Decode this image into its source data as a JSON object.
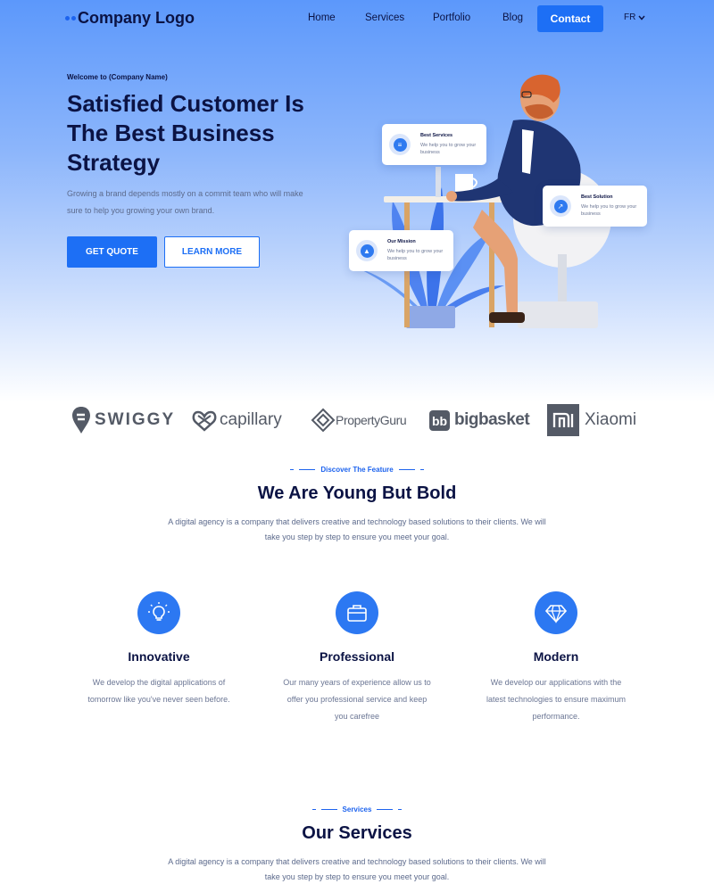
{
  "nav": {
    "logo": "Company Logo",
    "links": [
      "Home",
      "Services",
      "Portfolio",
      "Blog"
    ],
    "contact": "Contact",
    "language": "FR"
  },
  "hero": {
    "welcome": "Welcome to (Company Name)",
    "title": "Satisfied Customer Is The Best Business Strategy",
    "description": "Growing a brand depends mostly on a commit team who will make sure to help you growing your own brand.",
    "primary_button": "GET QUOTE",
    "secondary_button": "LEARN MORE",
    "cards": [
      {
        "title": "Best Services",
        "text": "We help you to grow your business",
        "icon": "layers-icon"
      },
      {
        "title": "Best Solution",
        "text": "We help you to grow your business",
        "icon": "chart-icon"
      },
      {
        "title": "Our Mission",
        "text": "We help you to grow your business",
        "icon": "rocket-icon"
      }
    ]
  },
  "brands": [
    "SWIGGY",
    "capillary",
    "PropertyGuru",
    "bigbasket",
    "Xiaomi"
  ],
  "features_section": {
    "eyebrow": "Discover The Feature",
    "title": "We Are Young But Bold",
    "description": "A digital agency is a company that delivers creative and technology based solutions to their clients. We will take you step by step to ensure you meet your goal.",
    "items": [
      {
        "title": "Innovative",
        "text": "We develop the digital applications of tomorrow like you've never seen before.",
        "icon": "lightbulb-icon"
      },
      {
        "title": "Professional",
        "text": "Our many years of experience allow us to offer you professional service and keep you carefree",
        "icon": "briefcase-icon"
      },
      {
        "title": "Modern",
        "text": "We develop our applications with the latest technologies to ensure maximum performance.",
        "icon": "diamond-icon"
      }
    ]
  },
  "services_section": {
    "eyebrow": "Services",
    "title": "Our Services",
    "description": "A digital agency is a company that delivers creative and technology based solutions to their clients. We will take you step by step to ensure you meet your goal."
  },
  "colors": {
    "primary": "#1d6ff5",
    "heading": "#0b1344",
    "body_text": "#5c6a8c",
    "hero_gradient_top": "#5c98fb"
  }
}
